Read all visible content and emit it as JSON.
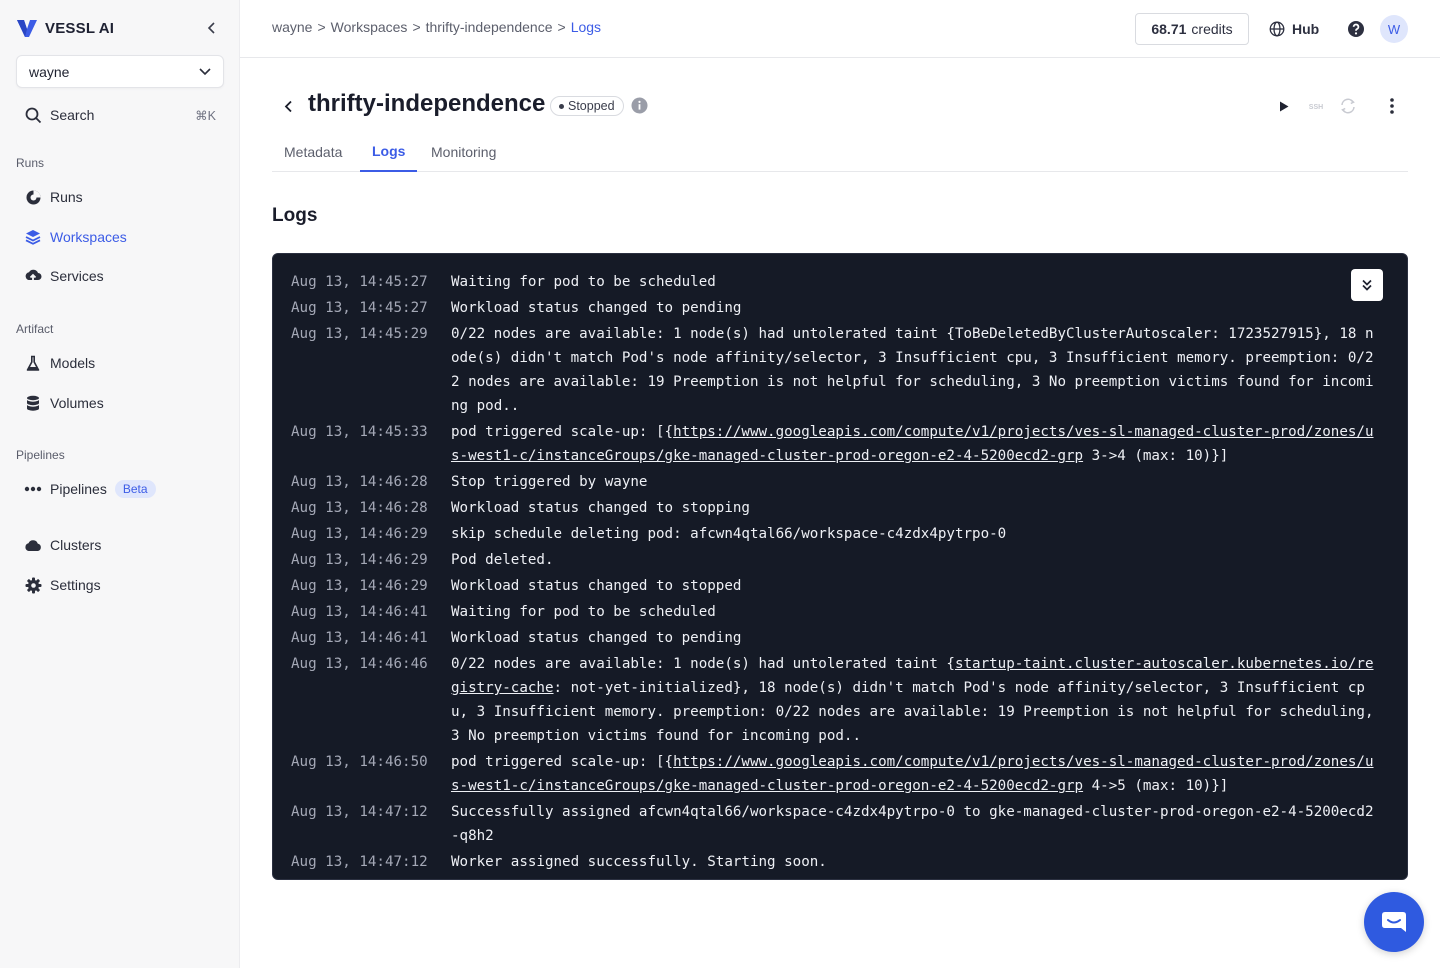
{
  "brand": {
    "name": "VESSL AI"
  },
  "org_select": {
    "value": "wayne"
  },
  "search": {
    "label": "Search",
    "shortcut": "⌘K"
  },
  "sidebar": {
    "sections": {
      "runs": "Runs",
      "artifact": "Artifact",
      "pipelines": "Pipelines"
    },
    "items": {
      "runs": "Runs",
      "workspaces": "Workspaces",
      "services": "Services",
      "models": "Models",
      "volumes": "Volumes",
      "pipelines": "Pipelines",
      "pipelines_badge": "Beta",
      "clusters": "Clusters",
      "settings": "Settings"
    },
    "active": "Workspaces"
  },
  "breadcrumb": {
    "items": [
      "wayne",
      "Workspaces",
      "thrifty-independence",
      "Logs"
    ],
    "separator": ">"
  },
  "header": {
    "credits_value": "68.71",
    "credits_label": "credits",
    "hub_label": "Hub",
    "avatar_initial": "W"
  },
  "workspace": {
    "title": "thrifty-independence",
    "status": "Stopped",
    "ssh_label": "SSH"
  },
  "tabs": [
    "Metadata",
    "Logs",
    "Monitoring"
  ],
  "active_tab": "Logs",
  "section_title": "Logs",
  "logs": [
    {
      "ts": "Aug 13, 14:45:27",
      "parts": [
        {
          "t": "Waiting for pod to be scheduled"
        }
      ]
    },
    {
      "ts": "Aug 13, 14:45:27",
      "parts": [
        {
          "t": "Workload status changed to pending"
        }
      ]
    },
    {
      "ts": "Aug 13, 14:45:29",
      "parts": [
        {
          "t": "0/22 nodes are available: 1 node(s) had untolerated taint {ToBeDeletedByClusterAutoscaler: 1723527915}, 18 node(s) didn't match Pod's node affinity/selector, 3 Insufficient cpu, 3 Insufficient memory. preemption: 0/22 nodes are available: 19 Preemption is not helpful for scheduling, 3 No preemption victims found for incoming pod.."
        }
      ]
    },
    {
      "ts": "Aug 13, 14:45:33",
      "parts": [
        {
          "t": "pod triggered scale-up: [{"
        },
        {
          "t": "https://www.googleapis.com/compute/v1/projects/ves-sl-managed-cluster-prod/zones/us-west1-c/instanceGroups/gke-managed-cluster-prod-oregon-e2-4-5200ecd2-grp",
          "link": true
        },
        {
          "t": " 3->4 (max: 10)}]"
        }
      ]
    },
    {
      "ts": "Aug 13, 14:46:28",
      "parts": [
        {
          "t": "Stop triggered by wayne"
        }
      ]
    },
    {
      "ts": "Aug 13, 14:46:28",
      "parts": [
        {
          "t": "Workload status changed to stopping"
        }
      ]
    },
    {
      "ts": "Aug 13, 14:46:29",
      "parts": [
        {
          "t": "skip schedule deleting pod: afcwn4qtal66/workspace-c4zdx4pytrpo-0"
        }
      ]
    },
    {
      "ts": "Aug 13, 14:46:29",
      "parts": [
        {
          "t": "Pod deleted."
        }
      ]
    },
    {
      "ts": "Aug 13, 14:46:29",
      "parts": [
        {
          "t": "Workload status changed to stopped"
        }
      ]
    },
    {
      "ts": "Aug 13, 14:46:41",
      "parts": [
        {
          "t": "Waiting for pod to be scheduled"
        }
      ]
    },
    {
      "ts": "Aug 13, 14:46:41",
      "parts": [
        {
          "t": "Workload status changed to pending"
        }
      ]
    },
    {
      "ts": "Aug 13, 14:46:46",
      "parts": [
        {
          "t": "0/22 nodes are available: 1 node(s) had untolerated taint {"
        },
        {
          "t": "startup-taint.cluster-autoscaler.kubernetes.io/registry-cache",
          "link": true
        },
        {
          "t": ": not-yet-initialized}, 18 node(s) didn't match Pod's node affinity/selector, 3 Insufficient cpu, 3 Insufficient memory. preemption: 0/22 nodes are available: 19 Preemption is not helpful for scheduling, 3 No preemption victims found for incoming pod.."
        }
      ]
    },
    {
      "ts": "Aug 13, 14:46:50",
      "parts": [
        {
          "t": "pod triggered scale-up: [{"
        },
        {
          "t": "https://www.googleapis.com/compute/v1/projects/ves-sl-managed-cluster-prod/zones/us-west1-c/instanceGroups/gke-managed-cluster-prod-oregon-e2-4-5200ecd2-grp",
          "link": true
        },
        {
          "t": " 4->5 (max: 10)}]"
        }
      ]
    },
    {
      "ts": "Aug 13, 14:47:12",
      "parts": [
        {
          "t": "Successfully assigned afcwn4qtal66/workspace-c4zdx4pytrpo-0 to gke-managed-cluster-prod-oregon-e2-4-5200ecd2-q8h2"
        }
      ]
    },
    {
      "ts": "Aug 13, 14:47:12",
      "parts": [
        {
          "t": "Worker assigned successfully. Starting soon."
        }
      ]
    }
  ],
  "colors": {
    "accent": "#3c5ce6",
    "log_bg": "#151a26",
    "log_text": "#eef0f5",
    "log_timestamp": "#a4a8b6"
  },
  "icons": {
    "brand": "vessl-logo-icon",
    "search": "search-icon",
    "runs": "runs-icon",
    "workspaces": "layers-icon",
    "services": "cloud-upload-icon",
    "models": "flask-icon",
    "volumes": "database-icon",
    "pipelines": "dots-icon",
    "clusters": "cloud-icon",
    "settings": "gear-icon"
  }
}
